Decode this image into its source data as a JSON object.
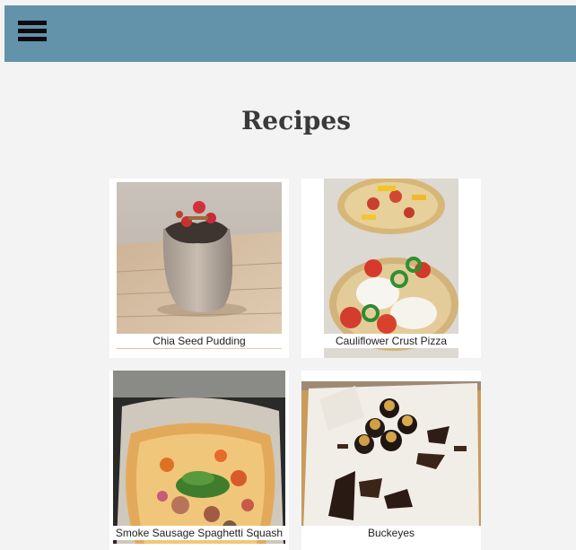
{
  "header": {
    "menu_icon": "hamburger-menu-icon",
    "bar_color": "#6393ab"
  },
  "page": {
    "title": "Recipes"
  },
  "recipes": [
    {
      "name": "Chia Seed Pudding"
    },
    {
      "name": "Cauliflower Crust Pizza"
    },
    {
      "name": "Smoke Sausage Spaghetti Squash"
    },
    {
      "name": "Buckeyes"
    }
  ]
}
